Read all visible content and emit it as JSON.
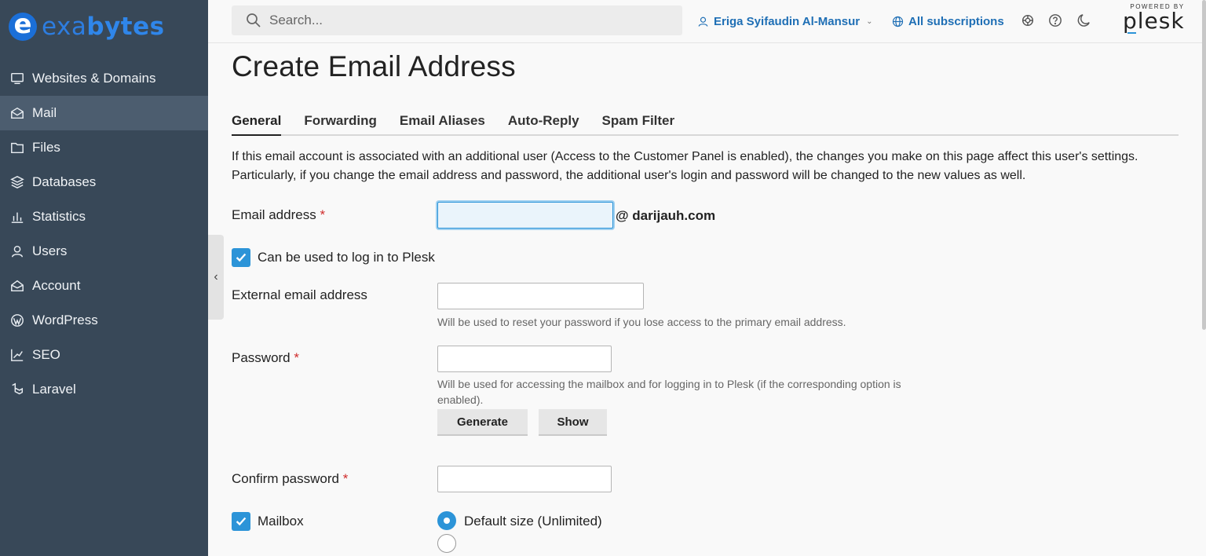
{
  "brand": {
    "logo_letter": "e",
    "logo_prefix": "exa",
    "logo_suffix": "bytes"
  },
  "sidebar": {
    "items": [
      {
        "label": "Websites & Domains",
        "icon": "monitor-icon"
      },
      {
        "label": "Mail",
        "icon": "mail-icon",
        "active": true
      },
      {
        "label": "Files",
        "icon": "folder-icon"
      },
      {
        "label": "Databases",
        "icon": "database-icon"
      },
      {
        "label": "Statistics",
        "icon": "bar-chart-icon"
      },
      {
        "label": "Users",
        "icon": "user-icon"
      },
      {
        "label": "Account",
        "icon": "account-icon"
      },
      {
        "label": "WordPress",
        "icon": "wordpress-icon"
      },
      {
        "label": "SEO",
        "icon": "seo-icon"
      },
      {
        "label": "Laravel",
        "icon": "laravel-icon"
      }
    ],
    "collapse_glyph": "‹"
  },
  "topbar": {
    "search_placeholder": "Search...",
    "user_name": "Eriga Syifaudin Al-Mansur",
    "subscriptions": "All subscriptions",
    "powered_by": "POWERED BY",
    "plesk": "plesk"
  },
  "page": {
    "title": "Create Email Address",
    "tabs": [
      "General",
      "Forwarding",
      "Email Aliases",
      "Auto-Reply",
      "Spam Filter"
    ],
    "notice": "If this email account is associated with an additional user (Access to the Customer Panel is enabled), the changes you make on this page affect this user's settings. Particularly, if you change the email address and password, the additional user's login and password will be changed to the new values as well."
  },
  "form": {
    "email_label": "Email address",
    "required_mark": "*",
    "email_value": "",
    "domain": "@ darijauh.com",
    "login_checkbox_label": "Can be used to log in to Plesk",
    "external_label": "External email address",
    "external_hint": "Will be used to reset your password if you lose access to the primary email address.",
    "password_label": "Password",
    "password_hint": "Will be used for accessing the mailbox and for logging in to Plesk (if the corresponding option is enabled).",
    "generate_button": "Generate",
    "show_button": "Show",
    "confirm_label": "Confirm password",
    "mailbox_label": "Mailbox",
    "default_size_label": "Default size (Unlimited)"
  },
  "colors": {
    "sidebar": "#384858",
    "sidebar_active": "#4c5d6f",
    "accent": "#2c94d8",
    "link": "#1f6fb5",
    "required": "#d02c2c"
  }
}
